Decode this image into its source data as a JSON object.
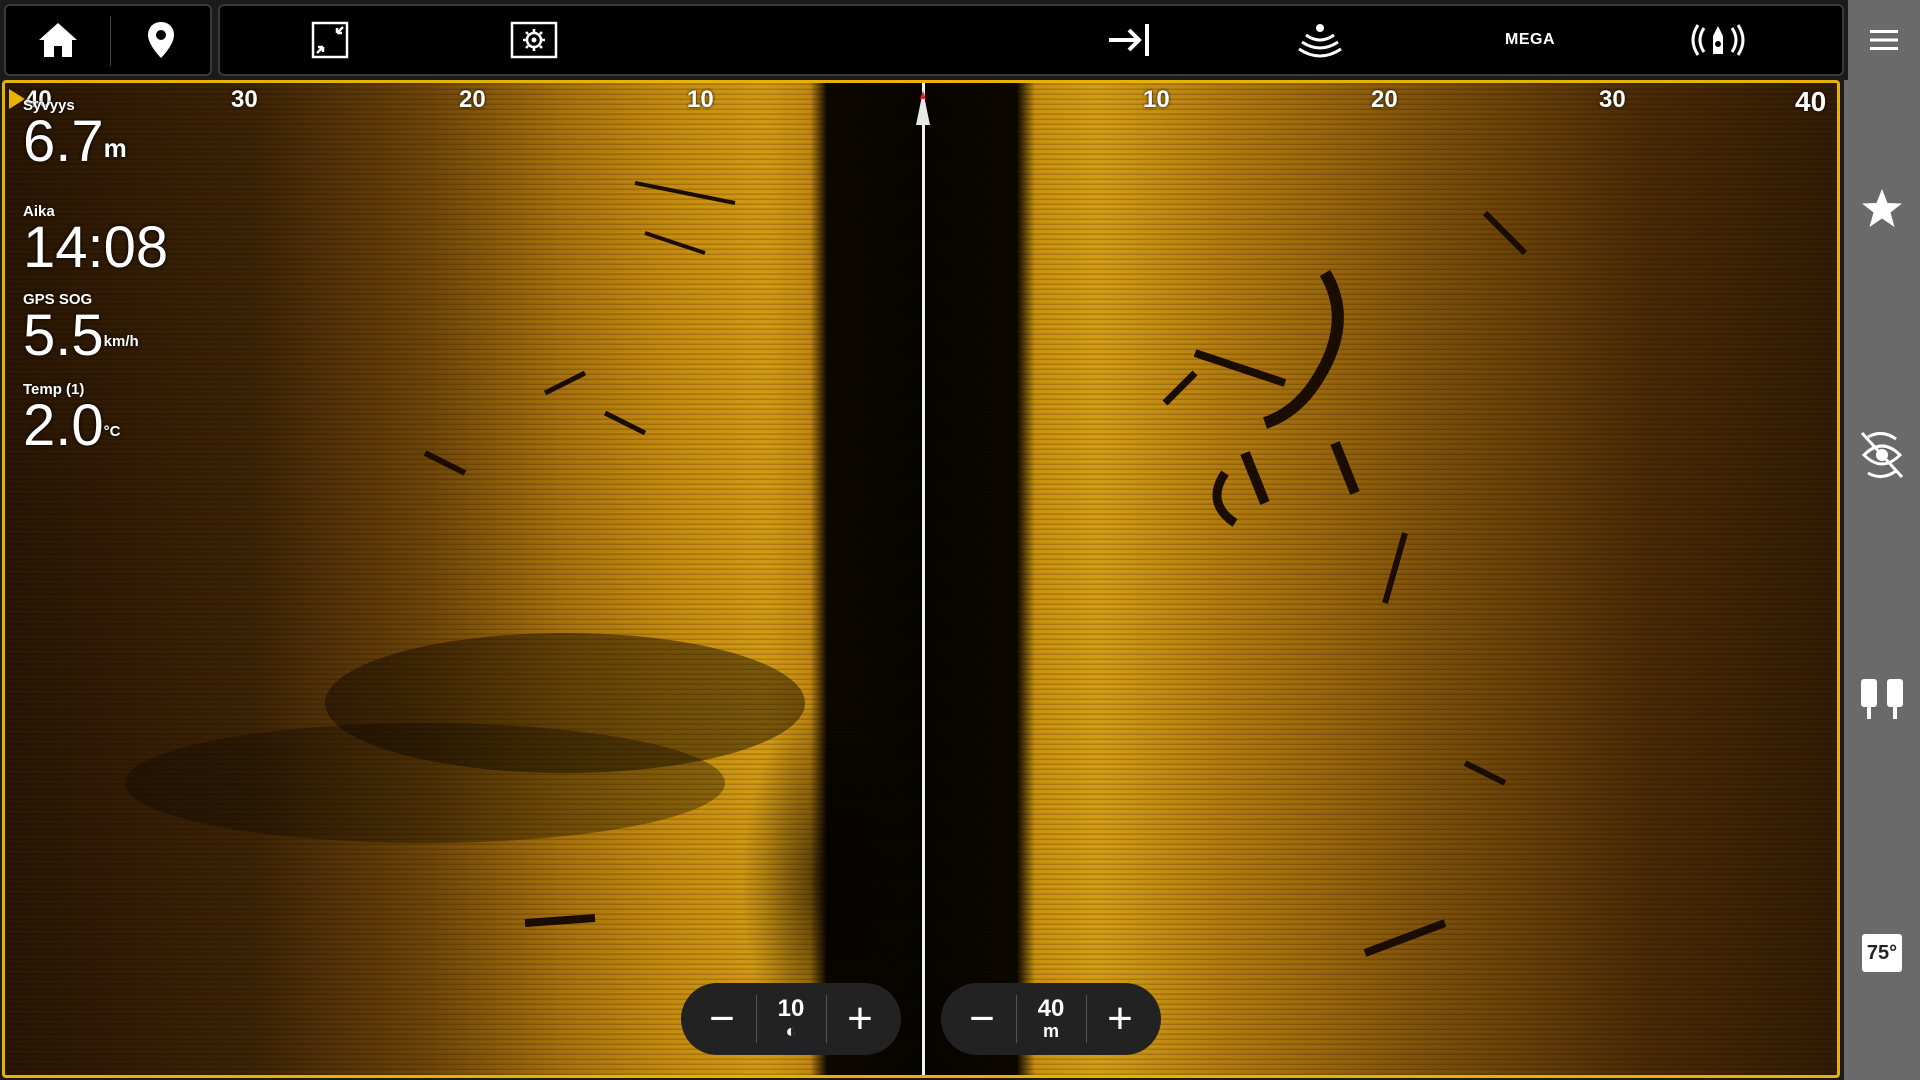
{
  "topbar": {
    "home_icon": "home-icon",
    "waypoint_icon": "map-pin-icon",
    "shrink_icon": "shrink-view-icon",
    "settings_icon": "sonar-settings-icon",
    "range_icon": "arrow-to-line-icon",
    "sonar_icon": "sonar-beam-icon",
    "mega_label": "MEGA",
    "transducer_icon": "transducer-ping-icon",
    "menu_icon": "hamburger-menu-icon"
  },
  "scale": {
    "left_labels": [
      "40",
      "30",
      "20",
      "10"
    ],
    "right_labels": [
      "10",
      "20",
      "30",
      "40"
    ]
  },
  "readouts": [
    {
      "label": "Syvyys",
      "value": "6.7",
      "unit": "m"
    },
    {
      "label": "Aika",
      "value": "14:08",
      "unit": ""
    },
    {
      "label": "GPS SOG",
      "value": "5.5",
      "unit": "km/h"
    },
    {
      "label": "Temp (1)",
      "value": "2.0",
      "unit": "°C"
    }
  ],
  "zoom_left": {
    "value": "10",
    "unit_icon": "contrast-icon"
  },
  "zoom_right": {
    "value": "40",
    "unit": "m"
  },
  "sidebar": {
    "favorite_icon": "star-icon",
    "view_icon": "eye-rotate-icon",
    "split_icon": "split-view-icon",
    "badge_value": "75°"
  },
  "colors": {
    "accent": "#e8b200",
    "sonar_bright": "#d29a14",
    "sonar_dark": "#2a1603",
    "panel": "#6a6a6a"
  }
}
